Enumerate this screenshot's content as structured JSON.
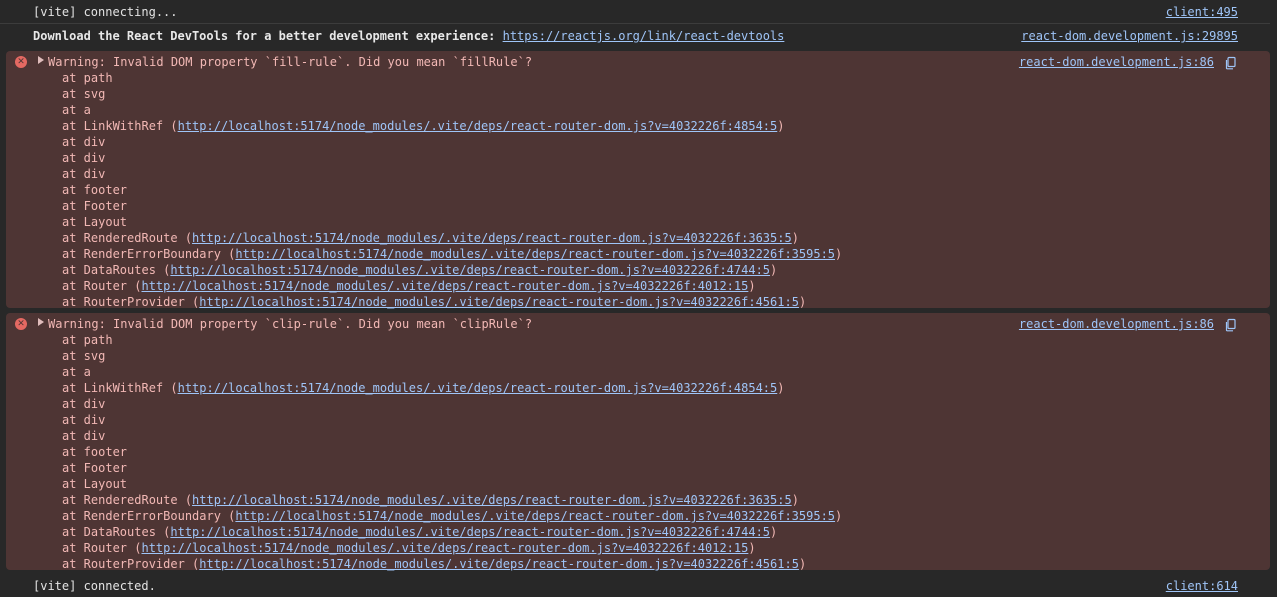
{
  "rows": {
    "vite_connecting": {
      "text": "[vite] connecting...",
      "source": "client:495"
    },
    "devtools": {
      "text": "Download the React DevTools for a better development experience: ",
      "link": "https://reactjs.org/link/react-devtools",
      "source": "react-dom.development.js:29895"
    },
    "vite_connected": {
      "text": "[vite] connected.",
      "source": "client:614"
    }
  },
  "errors": [
    {
      "message": "Warning: Invalid DOM property `fill-rule`. Did you mean `fillRule`?",
      "source": "react-dom.development.js:86",
      "frames": [
        {
          "name": "at path",
          "url": ""
        },
        {
          "name": "at svg",
          "url": ""
        },
        {
          "name": "at a",
          "url": ""
        },
        {
          "name": "at LinkWithRef (",
          "url": "http://localhost:5174/node_modules/.vite/deps/react-router-dom.js?v=4032226f:4854:5",
          "close": ")"
        },
        {
          "name": "at div",
          "url": ""
        },
        {
          "name": "at div",
          "url": ""
        },
        {
          "name": "at div",
          "url": ""
        },
        {
          "name": "at footer",
          "url": ""
        },
        {
          "name": "at Footer",
          "url": ""
        },
        {
          "name": "at Layout",
          "url": ""
        },
        {
          "name": "at RenderedRoute (",
          "url": "http://localhost:5174/node_modules/.vite/deps/react-router-dom.js?v=4032226f:3635:5",
          "close": ")"
        },
        {
          "name": "at RenderErrorBoundary (",
          "url": "http://localhost:5174/node_modules/.vite/deps/react-router-dom.js?v=4032226f:3595:5",
          "close": ")"
        },
        {
          "name": "at DataRoutes (",
          "url": "http://localhost:5174/node_modules/.vite/deps/react-router-dom.js?v=4032226f:4744:5",
          "close": ")"
        },
        {
          "name": "at Router (",
          "url": "http://localhost:5174/node_modules/.vite/deps/react-router-dom.js?v=4032226f:4012:15",
          "close": ")"
        },
        {
          "name": "at RouterProvider (",
          "url": "http://localhost:5174/node_modules/.vite/deps/react-router-dom.js?v=4032226f:4561:5",
          "close": ")"
        }
      ]
    },
    {
      "message": "Warning: Invalid DOM property `clip-rule`. Did you mean `clipRule`?",
      "source": "react-dom.development.js:86",
      "frames": [
        {
          "name": "at path",
          "url": ""
        },
        {
          "name": "at svg",
          "url": ""
        },
        {
          "name": "at a",
          "url": ""
        },
        {
          "name": "at LinkWithRef (",
          "url": "http://localhost:5174/node_modules/.vite/deps/react-router-dom.js?v=4032226f:4854:5",
          "close": ")"
        },
        {
          "name": "at div",
          "url": ""
        },
        {
          "name": "at div",
          "url": ""
        },
        {
          "name": "at div",
          "url": ""
        },
        {
          "name": "at footer",
          "url": ""
        },
        {
          "name": "at Footer",
          "url": ""
        },
        {
          "name": "at Layout",
          "url": ""
        },
        {
          "name": "at RenderedRoute (",
          "url": "http://localhost:5174/node_modules/.vite/deps/react-router-dom.js?v=4032226f:3635:5",
          "close": ")"
        },
        {
          "name": "at RenderErrorBoundary (",
          "url": "http://localhost:5174/node_modules/.vite/deps/react-router-dom.js?v=4032226f:3595:5",
          "close": ")"
        },
        {
          "name": "at DataRoutes (",
          "url": "http://localhost:5174/node_modules/.vite/deps/react-router-dom.js?v=4032226f:4744:5",
          "close": ")"
        },
        {
          "name": "at Router (",
          "url": "http://localhost:5174/node_modules/.vite/deps/react-router-dom.js?v=4032226f:4012:15",
          "close": ")"
        },
        {
          "name": "at RouterProvider (",
          "url": "http://localhost:5174/node_modules/.vite/deps/react-router-dom.js?v=4032226f:4561:5",
          "close": ")"
        }
      ]
    }
  ],
  "icons": {
    "error": "error-circle-icon",
    "expand": "disclosure-triangle-icon",
    "copy": "copy-icon"
  },
  "colors": {
    "background": "#282828",
    "error_bg": "#4e3534",
    "error_text": "#f2b8b5",
    "link": "#9fc5f8",
    "error_icon": "#e46962"
  }
}
